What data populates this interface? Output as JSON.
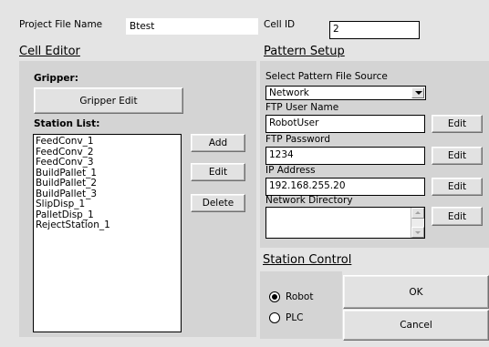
{
  "project": {
    "label": "Project File Name",
    "value": "Btest"
  },
  "cell": {
    "label": "Cell ID",
    "value": "2"
  },
  "cell_editor": {
    "heading": "Cell Editor",
    "gripper_label": "Gripper:",
    "gripper_button": "Gripper Edit",
    "station_list_label": "Station List:",
    "stations": [
      "FeedConv_1",
      "FeedConv_2",
      "FeedConv_3",
      "BuildPallet_1",
      "BuildPallet_2",
      "BuildPallet_3",
      "SlipDisp_1",
      "PalletDisp_1",
      "RejectStation_1"
    ],
    "add_button": "Add",
    "edit_button": "Edit",
    "delete_button": "Delete"
  },
  "pattern_setup": {
    "heading": "Pattern Setup",
    "source_label": "Select Pattern File Source",
    "source_value": "Network",
    "ftp_user_label": "FTP User Name",
    "ftp_user_value": "RobotUser",
    "ftp_password_label": "FTP Password",
    "ftp_password_value": "1234",
    "ip_label": "IP Address",
    "ip_value": "192.168.255.20",
    "network_dir_label": "Network Directory",
    "network_dir_value": "",
    "edit_label": "Edit"
  },
  "station_control": {
    "heading": "Station Control",
    "options": [
      {
        "label": "Robot",
        "selected": true
      },
      {
        "label": "PLC",
        "selected": false
      }
    ],
    "ok_button": "OK",
    "cancel_button": "Cancel"
  }
}
